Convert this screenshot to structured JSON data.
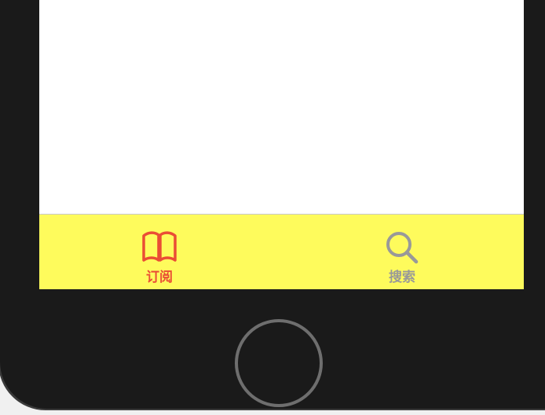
{
  "tab_bar": {
    "background": "#fefb5c",
    "active_color": "#ea4d35",
    "inactive_color": "#999999",
    "tabs": [
      {
        "label": "订阅",
        "icon": "book-icon",
        "active": true
      },
      {
        "label": "搜索",
        "icon": "search-icon",
        "active": false
      }
    ]
  },
  "device": {
    "frame_color": "#1a1a1a",
    "home_button_icon": "home-button"
  }
}
